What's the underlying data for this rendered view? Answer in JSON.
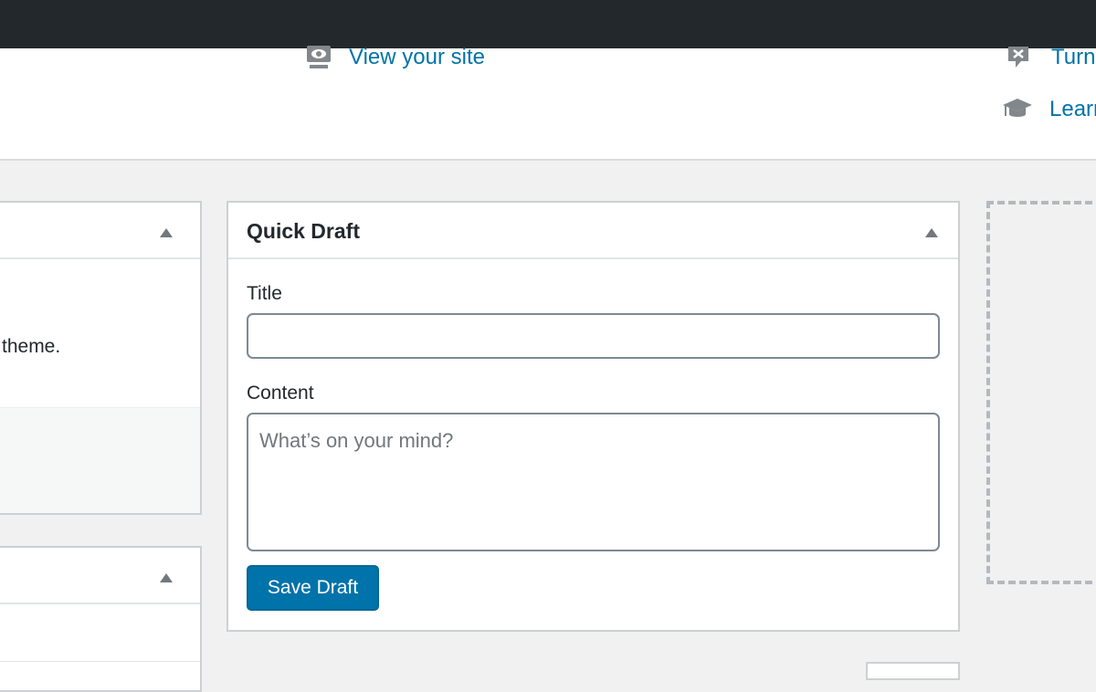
{
  "welcome": {
    "view_site_label": "View your site",
    "turn_label": "Turn",
    "learn_label": "Learn"
  },
  "left_panel": {
    "body_text": "theme."
  },
  "quick_draft": {
    "title": "Quick Draft",
    "title_label": "Title",
    "title_value": "",
    "content_label": "Content",
    "content_placeholder": "What’s on your mind?",
    "save_label": "Save Draft"
  },
  "icons": [
    "screen-eye-icon",
    "comment-close-icon",
    "graduation-cap-icon",
    "collapse-arrow-icon"
  ],
  "colors": {
    "link": "#0073aa",
    "button": "#0073aa",
    "admin_bar": "#23282d"
  }
}
